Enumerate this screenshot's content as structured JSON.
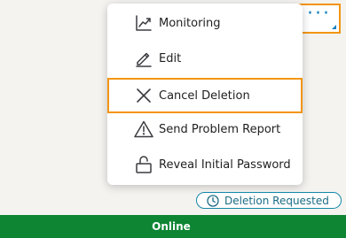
{
  "toolbar": {
    "more_label": "···",
    "more_icon": "more-horizontal-icon"
  },
  "menu": {
    "items": [
      {
        "label": "Monitoring",
        "icon": "trend-chart-icon"
      },
      {
        "label": "Edit",
        "icon": "pencil-icon"
      },
      {
        "label": "Cancel Deletion",
        "icon": "close-icon"
      },
      {
        "label": "Send Problem Report",
        "icon": "warning-triangle-icon"
      },
      {
        "label": "Reveal Initial Password",
        "icon": "unlock-icon"
      }
    ]
  },
  "status": {
    "badge_label": "Deletion Requested",
    "badge_icon": "clock-icon",
    "bar_label": "Online"
  },
  "colors": {
    "highlight": "#f39512",
    "accent": "#167fbf",
    "badge": "#1486a9",
    "online": "#0d8533"
  }
}
